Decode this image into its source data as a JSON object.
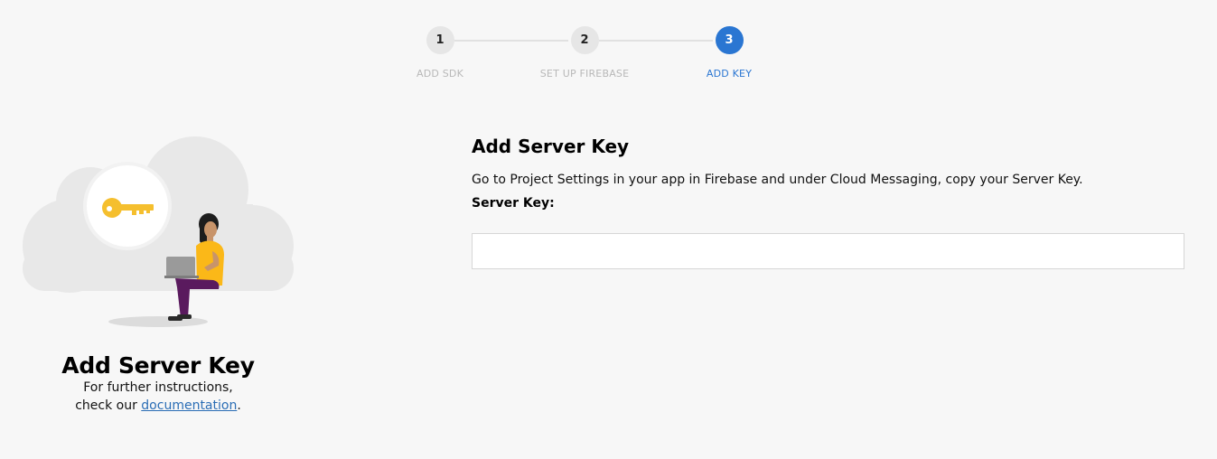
{
  "stepper": {
    "steps": [
      {
        "number": "1",
        "label": "ADD SDK",
        "state": "complete"
      },
      {
        "number": "2",
        "label": "SET UP FIREBASE",
        "state": "complete"
      },
      {
        "number": "3",
        "label": "ADD KEY",
        "state": "active"
      }
    ]
  },
  "left_panel": {
    "illustration_icon": "key-icon",
    "title": "Add Server Key",
    "line1": "For further instructions,",
    "line2_prefix": "check our ",
    "link_text": "documentation",
    "line2_suffix": "."
  },
  "form": {
    "title": "Add Server Key",
    "description": "Go to Project Settings in your app in Firebase and under Cloud Messaging, copy your Server Key.",
    "field_label": "Server Key:",
    "field_value": "",
    "field_placeholder": ""
  },
  "colors": {
    "accent": "#2a76d2",
    "background": "#f7f7f7",
    "key": "#f5bf2e",
    "shirt": "#fbb818",
    "pants": "#5a1a5e"
  }
}
